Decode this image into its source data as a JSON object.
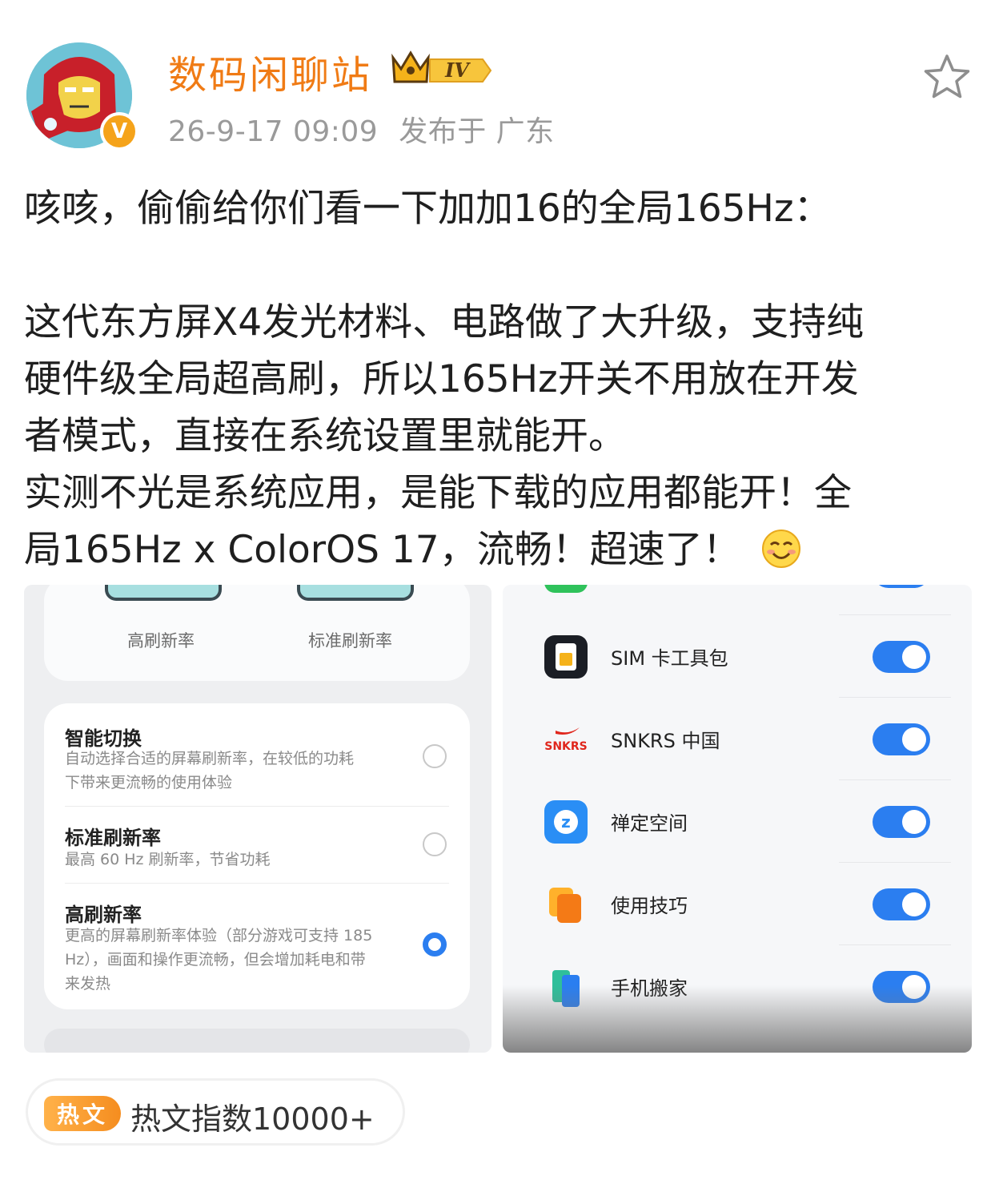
{
  "author": {
    "name": "数码闲聊站",
    "level_badge": "IV",
    "verified_mark": "V",
    "timestamp": "26-9-17 09:09",
    "location": "发布于 广东"
  },
  "post": {
    "lines": [
      "咳咳，偷偷给你们看一下加加16的全局165Hz：",
      "",
      "这代东方屏X4发光材料、电路做了大升级，支持纯",
      "硬件级全局超高刷，所以165Hz开关不用放在开发",
      "者模式，直接在系统设置里就能开。",
      "实测不光是系统应用，是能下载的应用都能开！全",
      "局165Hz x ColorOS 17，流畅！超速了！"
    ],
    "emoji": "smile-emoji"
  },
  "refresh_settings": {
    "preview_labels": [
      "高刷新率",
      "标准刷新率"
    ],
    "options": [
      {
        "title": "智能切换",
        "desc": [
          "自动选择合适的屏幕刷新率，在较低的功耗",
          "下带来更流畅的使用体验"
        ],
        "selected": false
      },
      {
        "title": "标准刷新率",
        "desc": [
          "最高 60 Hz 刷新率，节省功耗"
        ],
        "selected": false
      },
      {
        "title": "高刷新率",
        "desc": [
          "更高的屏幕刷新率体验（部分游戏可支持 185",
          "Hz），画面和操作更流畅，但会增加耗电和带",
          "来发热"
        ],
        "selected": true
      }
    ]
  },
  "app_list": {
    "apps": [
      {
        "name": "SIM 卡工具包",
        "icon": "sim-card-icon",
        "enabled": true
      },
      {
        "name": "SNKRS 中国",
        "icon": "snkrs-icon",
        "enabled": true
      },
      {
        "name": "禅定空间",
        "icon": "zen-space-icon",
        "enabled": true
      },
      {
        "name": "使用技巧",
        "icon": "tips-icon",
        "enabled": true
      },
      {
        "name": "手机搬家",
        "icon": "phone-clone-icon",
        "enabled": true
      }
    ],
    "toggle_color": "#2b7ef0"
  },
  "hot": {
    "tag": "热文",
    "text": "热文指数10000+"
  },
  "colors": {
    "username": "#f07b15",
    "meta": "#9a9a9a",
    "accent_blue": "#2b7ef0"
  }
}
